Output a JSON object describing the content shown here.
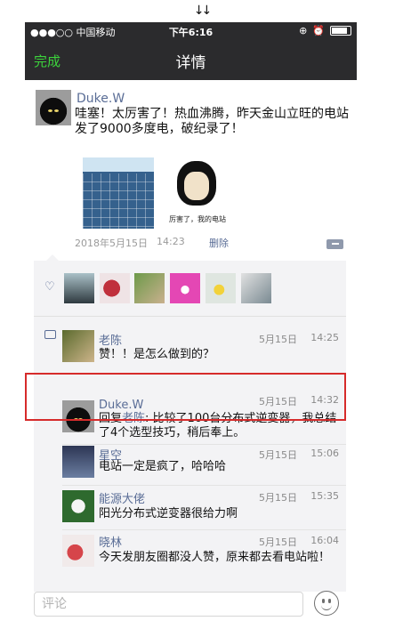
{
  "top_arrows": "↓↓",
  "status_bar": {
    "carrier": "●●●○○ 中国移动",
    "time": "下午6:16"
  },
  "nav": {
    "done_label": "完成",
    "title": "详情"
  },
  "post": {
    "author": "Duke.W",
    "text": "哇塞！太厉害了！热血沸腾，昨天金山立旺的电站发了9000多度电，破纪录了！",
    "image_caption": "厉害了，我的电站",
    "date": "2018年5月15日",
    "time": "14:23",
    "delete_label": "删除"
  },
  "comments": [
    {
      "name": "老陈",
      "date": "5月15日",
      "time": "14:25",
      "text": "赞！！是怎么做到的？"
    },
    {
      "name": "Duke.W",
      "date": "5月15日",
      "time": "14:32",
      "reply_prefix": "回复",
      "reply_to": "老陈",
      "text": ": 比较了100台分布式逆变器，我总结了4个选型技巧，稍后奉上。"
    },
    {
      "name": "星空",
      "date": "5月15日",
      "time": "15:06",
      "text": "电站一定是疯了，哈哈哈"
    },
    {
      "name": "能源大佬",
      "date": "5月15日",
      "time": "15:35",
      "text": "阳光分布式逆变器很给力啊"
    },
    {
      "name": "晓林",
      "date": "5月15日",
      "time": "16:04",
      "text": "今天发朋友圈都没人赞，原来都去看电站啦！"
    }
  ],
  "comment_input": {
    "placeholder": "评论"
  },
  "colors": {
    "accent_green": "#3cd33c",
    "link_blue": "#5a6d96",
    "highlight_red": "#d62b2b"
  }
}
